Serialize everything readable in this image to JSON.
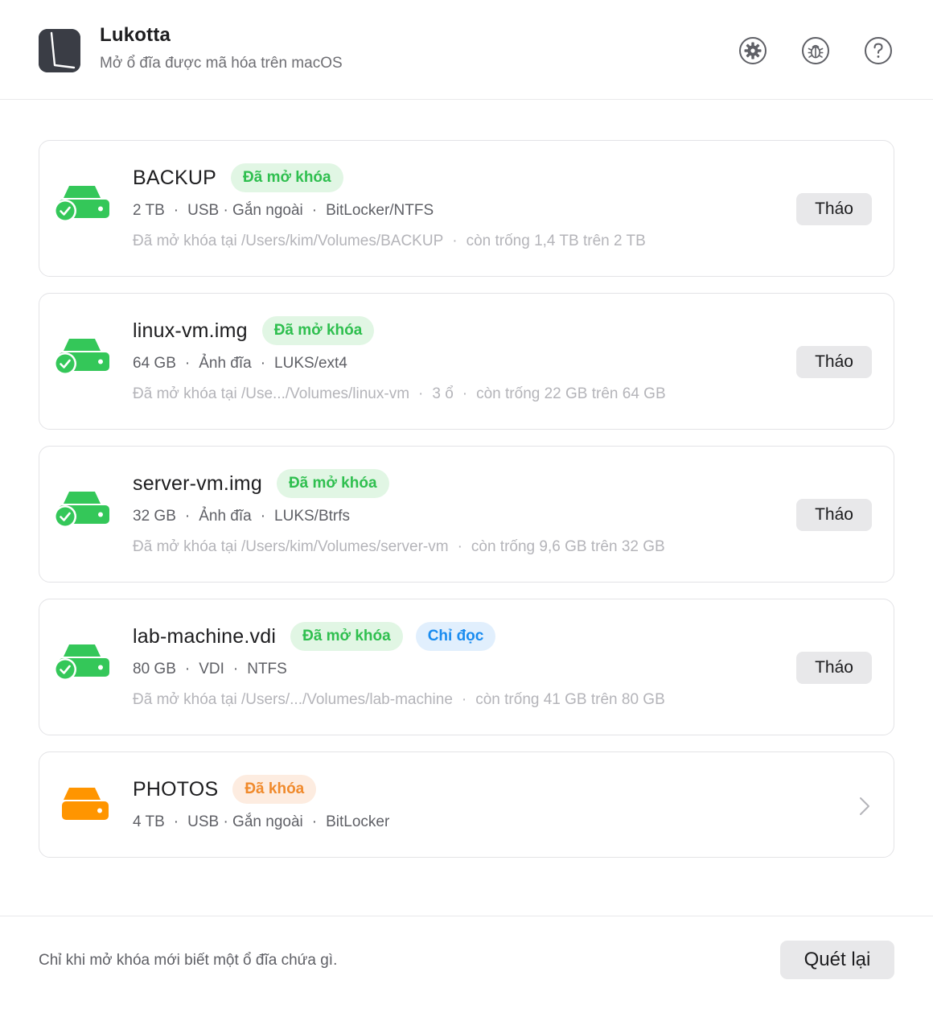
{
  "app": {
    "name": "Lukotta",
    "subtitle": "Mở ổ đĩa được mã hóa trên macOS"
  },
  "header_icons": [
    "gear-icon",
    "bug-icon",
    "help-icon"
  ],
  "colors": {
    "unlocked": "#34c759",
    "locked": "#ff9500",
    "read_only": "#1a8cf0"
  },
  "drives": [
    {
      "name": "BACKUP",
      "status": "Đã mở khóa",
      "extra_badge": "",
      "meta": [
        "2 TB",
        "USB · Gắn ngoài",
        "BitLocker/NTFS"
      ],
      "details": [
        "Đã mở khóa tại /Users/kim/Volumes/BACKUP",
        "còn trống 1,4 TB trên 2 TB"
      ],
      "action": "Tháo"
    },
    {
      "name": "linux-vm.img",
      "status": "Đã mở khóa",
      "extra_badge": "",
      "meta": [
        "64 GB",
        "Ảnh đĩa",
        "LUKS/ext4"
      ],
      "details": [
        "Đã mở khóa tại /Use.../Volumes/linux-vm",
        "3 ổ",
        "còn trống 22 GB trên 64 GB"
      ],
      "action": "Tháo"
    },
    {
      "name": "server-vm.img",
      "status": "Đã mở khóa",
      "extra_badge": "",
      "meta": [
        "32 GB",
        "Ảnh đĩa",
        "LUKS/Btrfs"
      ],
      "details": [
        "Đã mở khóa tại /Users/kim/Volumes/server-vm",
        "còn trống 9,6 GB trên 32 GB"
      ],
      "action": "Tháo"
    },
    {
      "name": "lab-machine.vdi",
      "status": "Đã mở khóa",
      "extra_badge": "Chỉ đọc",
      "meta": [
        "80 GB",
        "VDI",
        "NTFS"
      ],
      "details": [
        "Đã mở khóa tại /Users/.../Volumes/lab-machine",
        "còn trống 41 GB trên 80 GB"
      ],
      "action": "Tháo"
    },
    {
      "name": "PHOTOS",
      "status": "Đã khóa",
      "extra_badge": "",
      "meta": [
        "4 TB",
        "USB · Gắn ngoài",
        "BitLocker"
      ],
      "details": [],
      "action": ""
    }
  ],
  "footer": {
    "note": "Chỉ khi mở khóa mới biết một ổ đĩa chứa gì.",
    "rescan_label": "Quét lại"
  }
}
